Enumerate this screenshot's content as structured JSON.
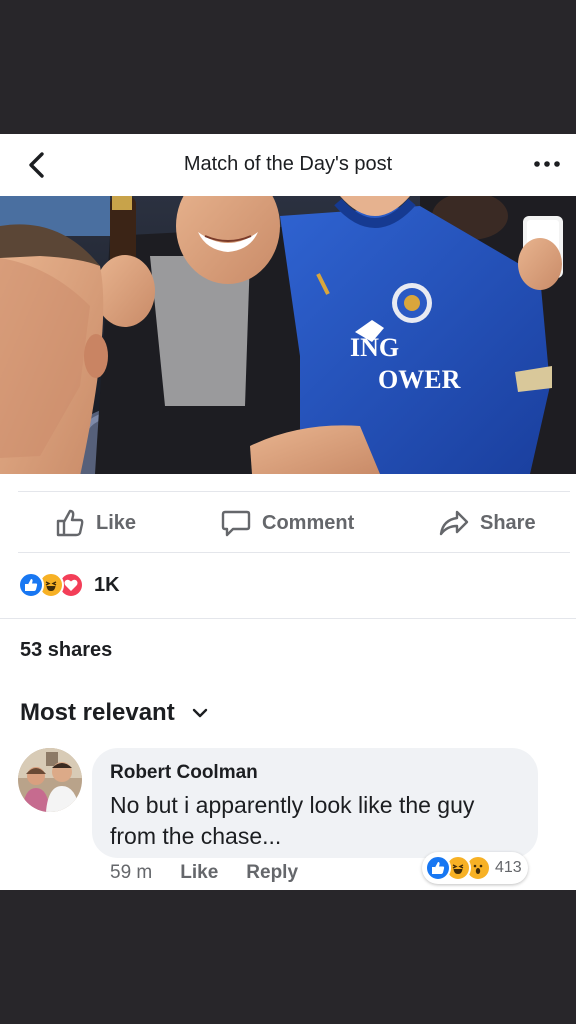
{
  "header": {
    "title": "Match of the Day's post",
    "back_icon": "back-arrow-icon",
    "more_icon": "more-options-icon"
  },
  "photo": {
    "shirt_sponsor_lines": [
      "ING",
      "OWER"
    ]
  },
  "actions": {
    "like_label": "Like",
    "comment_label": "Comment",
    "share_label": "Share"
  },
  "reactions": {
    "types": [
      "like",
      "haha",
      "love"
    ],
    "count": "1K"
  },
  "shares": "53 shares",
  "sort": {
    "label": "Most relevant"
  },
  "comment": {
    "author": "Robert Coolman",
    "text": "No but i apparently look like the guy from the chase...",
    "time": "59 m",
    "like_label": "Like",
    "reply_label": "Reply",
    "reaction_types": [
      "like",
      "haha",
      "wow"
    ],
    "reaction_count": "413"
  },
  "colors": {
    "background": "#28262a",
    "panel": "#ffffff",
    "like_blue": "#1877f2",
    "love_red": "#f33e58",
    "haha_yellow": "#f7b125",
    "secondary_text": "#65676b",
    "comment_bubble": "#f0f2f5",
    "jersey_blue": "#1f4fb8"
  }
}
